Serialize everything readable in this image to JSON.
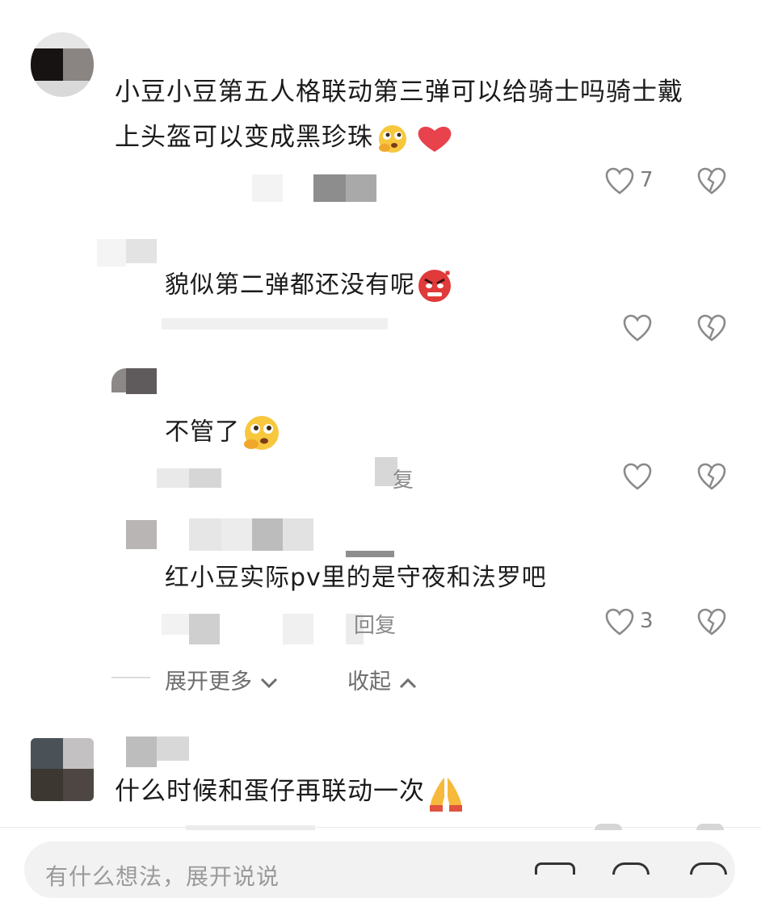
{
  "comments": [
    {
      "text_line1": "小豆小豆第五人格联动第三弹可以给骑士吗骑士戴",
      "text_line2": "上头盔可以变成黑珍珠",
      "likes": "7",
      "replies": [
        {
          "text": "貌似第二弹都还没有呢",
          "meta": "",
          "likes": ""
        },
        {
          "text": "不管了",
          "meta": "",
          "likes": ""
        },
        {
          "text": "红小豆实际pv里的是守夜和法罗吧",
          "meta": "回复",
          "likes": "3"
        }
      ],
      "expand_label": "展开更多",
      "collapse_label": "收起"
    },
    {
      "text": "什么时候和蛋仔再联动一次",
      "likes": ""
    }
  ],
  "bottom": {
    "input_placeholder": "有什么想法，展开说说"
  },
  "colors": {
    "text": "#1b1b1b",
    "meta": "#8a8a8a",
    "heart_emoji": "#e8424d"
  }
}
